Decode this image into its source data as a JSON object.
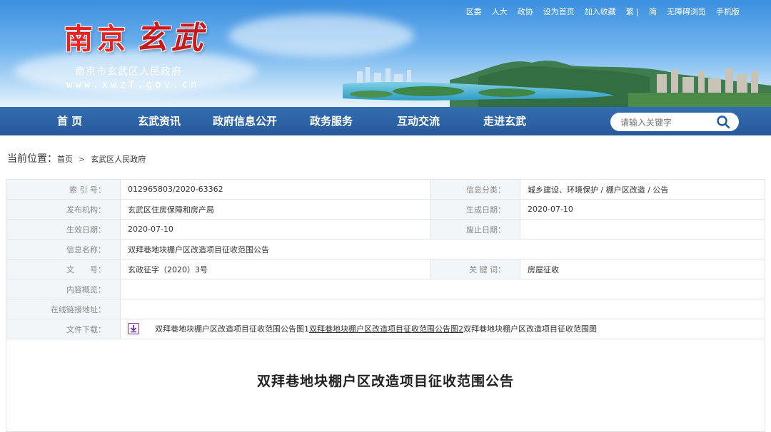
{
  "header": {
    "logo_text_part1": "南京",
    "logo_text_part2": "玄武",
    "gov_name": "南京市玄武区人民政府",
    "site_url": "www.xwzf.gov.cn",
    "top_links": [
      "区委",
      "人大",
      "政协",
      "设为首页",
      "加入收藏",
      "繁 |",
      "简",
      "无障碍浏览",
      "手机版"
    ]
  },
  "nav": {
    "items": [
      "首  页",
      "玄武资讯",
      "政府信息公开",
      "政务服务",
      "互动交流",
      "走进玄武"
    ],
    "search_placeholder": "请输入关键字",
    "search_icon": "search-icon"
  },
  "breadcrumb": {
    "label": "当前位置：",
    "home": "首页",
    "separator": ">",
    "current": "玄武区人民政府"
  },
  "info": {
    "index_label": "索 引 号：",
    "index_value": "012965803/2020-63362",
    "category_label": "信息分类：",
    "category_value": "城乡建设、环境保护 / 棚户区改造 / 公告",
    "publisher_label": "发布机构：",
    "publisher_value": "玄武区住房保障和房产局",
    "created_label": "生成日期：",
    "created_value": "2020-07-10",
    "effective_label": "生效日期：",
    "effective_value": "2020-07-10",
    "expire_label": "废止日期：",
    "expire_value": "",
    "name_label": "信息名称：",
    "name_value": "双拜巷地块棚户区改造项目征收范围公告",
    "docno_label": "文　　号：",
    "docno_value": "玄政征字（2020）3号",
    "keyword_label": "关 键 词：",
    "keyword_value": "房屋征收",
    "summary_label": "内容概览：",
    "summary_value": "",
    "link_label": "在线链接地址：",
    "link_value": "",
    "download_label": "文件下载：",
    "download_icon": "download-icon",
    "files": [
      "双拜巷地块棚户区改造项目征收范围公告图1",
      "双拜巷地块棚户区改造项目征收范围公告图2",
      "双拜巷地块棚户区改造项目征收范围图"
    ]
  },
  "article": {
    "title": "双拜巷地块棚户区改造项目征收范围公告"
  },
  "colors": {
    "nav_bg": "#1f5aa3",
    "logo_red": "#e8231f",
    "label_bg": "#f3f6f9",
    "border": "#dfe4ea",
    "download_icon": "#7b2fb5"
  }
}
